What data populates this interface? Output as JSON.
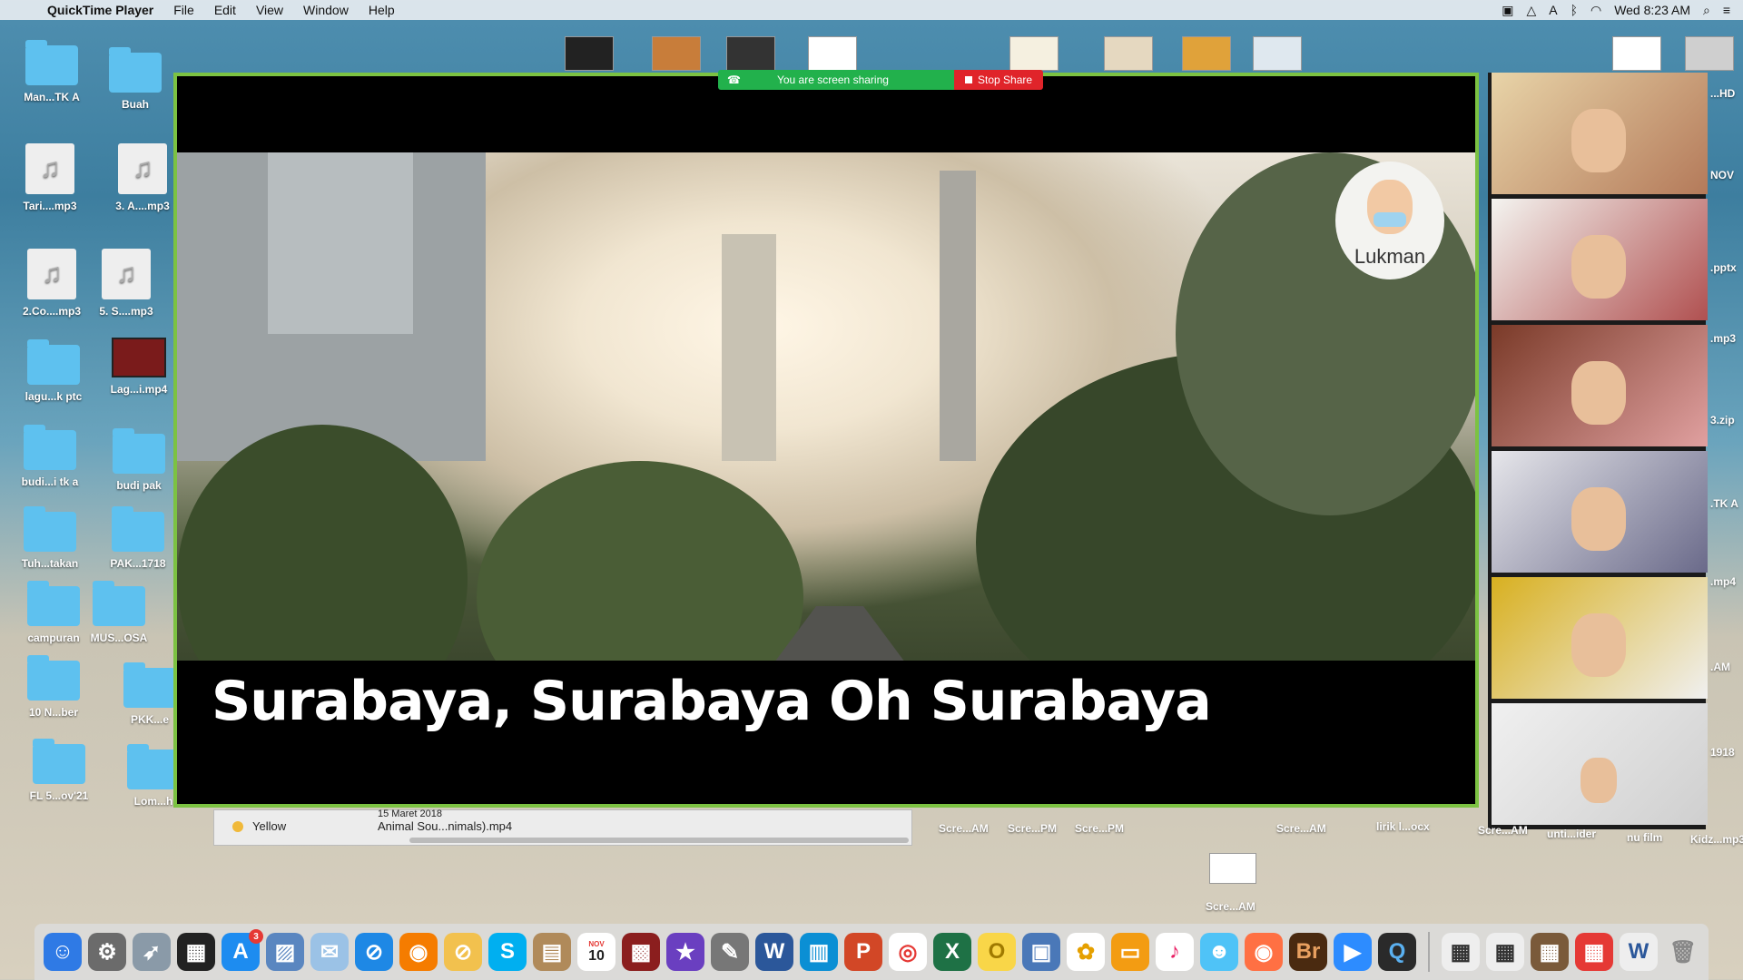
{
  "menubar": {
    "app_name": "QuickTime Player",
    "menus": [
      "File",
      "Edit",
      "View",
      "Window",
      "Help"
    ],
    "clock": "Wed 8:23 AM"
  },
  "desktop_icons": [
    {
      "label": "Man...TK A",
      "type": "folder"
    },
    {
      "label": "Buah",
      "type": "folder"
    },
    {
      "label": "Tari....mp3",
      "type": "audio"
    },
    {
      "label": "3. A....mp3",
      "type": "audio"
    },
    {
      "label": "2.Co....mp3",
      "type": "audio"
    },
    {
      "label": "5. S....mp3",
      "type": "audio"
    },
    {
      "label": "lagu...k ptc",
      "type": "folder"
    },
    {
      "label": "Lag...i.mp4",
      "type": "video"
    },
    {
      "label": "budi...i tk a",
      "type": "folder"
    },
    {
      "label": "budi pak",
      "type": "folder"
    },
    {
      "label": "Tuh...takan",
      "type": "folder"
    },
    {
      "label": "PAK...1718",
      "type": "folder"
    },
    {
      "label": "campuran",
      "type": "folder"
    },
    {
      "label": "MUS...OSA",
      "type": "folder"
    },
    {
      "label": "10 N...ber",
      "type": "folder"
    },
    {
      "label": "PKK...e",
      "type": "folder"
    },
    {
      "label": "FL 5...ov'21",
      "type": "folder"
    },
    {
      "label": "Lom...h",
      "type": "folder"
    }
  ],
  "right_edge_labels": [
    "...HD",
    "NOV",
    ".pptx",
    ".mp3",
    "3.zip",
    ".TK A",
    ".mp4",
    ".AM",
    "1918",
    "Kidz...mp3"
  ],
  "bottom_labels": [
    "Scre...AM",
    "Scre...PM",
    "Scre...PM",
    "Scre...AM",
    "lirik l...ocx",
    "Scre...AM",
    "unti...ider",
    "nu film",
    "Scre...AM"
  ],
  "zoom": {
    "share_status": "You are screen sharing",
    "stop_share": "Stop Share",
    "caption": "Surabaya, Surabaya Oh Surabaya",
    "host_name": "Lukman",
    "gallery_count": 6
  },
  "finder_strip": {
    "tag": "Yellow",
    "date_partial": "15 Maret 2018",
    "file": "Animal Sou...nimals).mp4"
  },
  "dock": {
    "apps": [
      "Finder",
      "System Preferences",
      "Launchpad",
      "Photo Booth",
      "App Store",
      "Preview",
      "Mail",
      "Safari",
      "Firefox",
      "Prohibited",
      "Skype",
      "Contacts",
      "Calendar",
      "Photo Booth 2",
      "iMovie",
      "Script Editor",
      "Word",
      "Keynote",
      "PowerPoint",
      "Chrome",
      "Excel",
      "Notes",
      "Archive",
      "Photos",
      "Books",
      "Music",
      "Messages",
      "Firefox 2",
      "Bridge",
      "Zoom",
      "QuickTime"
    ],
    "calendar_day": "10",
    "calendar_month": "NOV",
    "badge_app_store": "3"
  }
}
